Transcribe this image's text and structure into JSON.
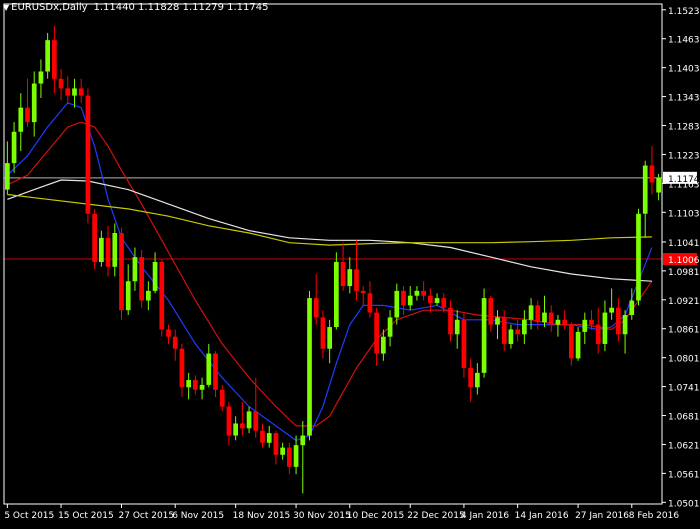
{
  "header": {
    "symbol": "EURUSDx,Daily",
    "ohlc": "1.11440 1.11828 1.11279 1.11745"
  },
  "price_tags": {
    "current": "1.11745",
    "line2": "1.10061"
  },
  "colors": {
    "background": "#000000",
    "axis": "#ffffff",
    "bull": "#7cff00",
    "bear": "#ff0000",
    "ma_fast": "#1e3cff",
    "ma_mid": "#d01010",
    "ma_long_white": "#e6e6e6",
    "ma_long_yellow": "#c8c800",
    "hline_current": "#b4b4b4",
    "hline_red": "#c80000",
    "tag_current_bg": "#ffffff",
    "tag_red_bg": "#ff0000"
  },
  "chart_data": {
    "type": "candlestick",
    "title": "EURUSDx,Daily",
    "y_ticks": [
      "1.15230",
      "1.14630",
      "1.14030",
      "1.13430",
      "1.12830",
      "1.12230",
      "1.11630",
      "1.11030",
      "1.10415",
      "1.09815",
      "1.09215",
      "1.08615",
      "1.08015",
      "1.07415",
      "1.06815",
      "1.06215",
      "1.05615",
      "1.05015"
    ],
    "y_tick_values": [
      1.1523,
      1.1463,
      1.1403,
      1.1343,
      1.1283,
      1.1223,
      1.1163,
      1.1103,
      1.10415,
      1.09815,
      1.09215,
      1.08615,
      1.08015,
      1.07415,
      1.06815,
      1.06215,
      1.05615,
      1.05015
    ],
    "ylim": [
      1.0498,
      1.1535
    ],
    "x_labels": [
      "5 Oct 2015",
      "15 Oct 2015",
      "27 Oct 2015",
      "6 Nov 2015",
      "18 Nov 2015",
      "30 Nov 2015",
      "10 Dec 2015",
      "22 Dec 2015",
      "4 Jan 2016",
      "14 Jan 2016",
      "27 Jan 2016",
      "8 Feb 2016"
    ],
    "x_label_bar_index": [
      0,
      8,
      17,
      25,
      34,
      43,
      51,
      60,
      68,
      76,
      85,
      93
    ],
    "candles": [
      {
        "o": 1.115,
        "h": 1.125,
        "l": 1.114,
        "c": 1.1205
      },
      {
        "o": 1.1205,
        "h": 1.129,
        "l": 1.1185,
        "c": 1.127
      },
      {
        "o": 1.127,
        "h": 1.135,
        "l": 1.123,
        "c": 1.132
      },
      {
        "o": 1.132,
        "h": 1.138,
        "l": 1.128,
        "c": 1.129
      },
      {
        "o": 1.129,
        "h": 1.1395,
        "l": 1.126,
        "c": 1.137
      },
      {
        "o": 1.137,
        "h": 1.142,
        "l": 1.134,
        "c": 1.1395
      },
      {
        "o": 1.1395,
        "h": 1.1475,
        "l": 1.138,
        "c": 1.146
      },
      {
        "o": 1.146,
        "h": 1.149,
        "l": 1.135,
        "c": 1.138
      },
      {
        "o": 1.138,
        "h": 1.14,
        "l": 1.1335,
        "c": 1.136
      },
      {
        "o": 1.136,
        "h": 1.1385,
        "l": 1.133,
        "c": 1.1345
      },
      {
        "o": 1.1345,
        "h": 1.138,
        "l": 1.132,
        "c": 1.136
      },
      {
        "o": 1.136,
        "h": 1.138,
        "l": 1.133,
        "c": 1.1345
      },
      {
        "o": 1.1345,
        "h": 1.136,
        "l": 1.108,
        "c": 1.11
      },
      {
        "o": 1.11,
        "h": 1.111,
        "l": 1.0985,
        "c": 1.1
      },
      {
        "o": 1.1,
        "h": 1.1065,
        "l": 1.099,
        "c": 1.105
      },
      {
        "o": 1.105,
        "h": 1.1075,
        "l": 1.097,
        "c": 1.099
      },
      {
        "o": 1.099,
        "h": 1.108,
        "l": 1.097,
        "c": 1.106
      },
      {
        "o": 1.106,
        "h": 1.107,
        "l": 1.088,
        "c": 1.09
      },
      {
        "o": 1.09,
        "h": 1.0995,
        "l": 1.089,
        "c": 1.096
      },
      {
        "o": 1.096,
        "h": 1.103,
        "l": 1.094,
        "c": 1.101
      },
      {
        "o": 1.101,
        "h": 1.1025,
        "l": 1.0905,
        "c": 1.092
      },
      {
        "o": 1.092,
        "h": 1.096,
        "l": 1.09,
        "c": 1.094
      },
      {
        "o": 1.094,
        "h": 1.102,
        "l": 1.0935,
        "c": 1.1
      },
      {
        "o": 1.1,
        "h": 1.1005,
        "l": 1.0845,
        "c": 1.086
      },
      {
        "o": 1.086,
        "h": 1.087,
        "l": 1.083,
        "c": 1.0845
      },
      {
        "o": 1.0845,
        "h": 1.086,
        "l": 1.0795,
        "c": 1.082
      },
      {
        "o": 1.082,
        "h": 1.083,
        "l": 1.072,
        "c": 1.074
      },
      {
        "o": 1.074,
        "h": 1.077,
        "l": 1.0715,
        "c": 1.0755
      },
      {
        "o": 1.0755,
        "h": 1.0765,
        "l": 1.0725,
        "c": 1.0735
      },
      {
        "o": 1.0735,
        "h": 1.076,
        "l": 1.0715,
        "c": 1.0745
      },
      {
        "o": 1.0745,
        "h": 1.083,
        "l": 1.074,
        "c": 1.081
      },
      {
        "o": 1.081,
        "h": 1.0815,
        "l": 1.072,
        "c": 1.0735
      },
      {
        "o": 1.0735,
        "h": 1.0745,
        "l": 1.069,
        "c": 1.07
      },
      {
        "o": 1.07,
        "h": 1.071,
        "l": 1.062,
        "c": 1.064
      },
      {
        "o": 1.064,
        "h": 1.068,
        "l": 1.063,
        "c": 1.0665
      },
      {
        "o": 1.0665,
        "h": 1.071,
        "l": 1.064,
        "c": 1.0655
      },
      {
        "o": 1.0655,
        "h": 1.07,
        "l": 1.0645,
        "c": 1.069
      },
      {
        "o": 1.069,
        "h": 1.076,
        "l": 1.0635,
        "c": 1.065
      },
      {
        "o": 1.065,
        "h": 1.0665,
        "l": 1.0615,
        "c": 1.0625
      },
      {
        "o": 1.0625,
        "h": 1.066,
        "l": 1.0615,
        "c": 1.0645
      },
      {
        "o": 1.0645,
        "h": 1.065,
        "l": 1.058,
        "c": 1.06
      },
      {
        "o": 1.06,
        "h": 1.0625,
        "l": 1.059,
        "c": 1.0615
      },
      {
        "o": 1.0615,
        "h": 1.0625,
        "l": 1.056,
        "c": 1.0575
      },
      {
        "o": 1.0575,
        "h": 1.064,
        "l": 1.056,
        "c": 1.062
      },
      {
        "o": 1.062,
        "h": 1.067,
        "l": 1.052,
        "c": 1.064
      },
      {
        "o": 1.064,
        "h": 1.094,
        "l": 1.063,
        "c": 1.0925
      },
      {
        "o": 1.0925,
        "h": 1.0975,
        "l": 1.087,
        "c": 1.0885
      },
      {
        "o": 1.0885,
        "h": 1.09,
        "l": 1.08,
        "c": 1.082
      },
      {
        "o": 1.082,
        "h": 1.088,
        "l": 1.079,
        "c": 1.0865
      },
      {
        "o": 1.0865,
        "h": 1.102,
        "l": 1.086,
        "c": 1.1
      },
      {
        "o": 1.1,
        "h": 1.104,
        "l": 1.094,
        "c": 1.095
      },
      {
        "o": 1.095,
        "h": 1.101,
        "l": 1.0935,
        "c": 1.0985
      },
      {
        "o": 1.0985,
        "h": 1.1045,
        "l": 1.092,
        "c": 1.094
      },
      {
        "o": 1.094,
        "h": 1.095,
        "l": 1.091,
        "c": 1.0935
      },
      {
        "o": 1.0935,
        "h": 1.096,
        "l": 1.0885,
        "c": 1.0895
      },
      {
        "o": 1.0895,
        "h": 1.0905,
        "l": 1.0785,
        "c": 1.081
      },
      {
        "o": 1.081,
        "h": 1.086,
        "l": 1.0795,
        "c": 1.0845
      },
      {
        "o": 1.0845,
        "h": 1.09,
        "l": 1.0825,
        "c": 1.0885
      },
      {
        "o": 1.0885,
        "h": 1.0955,
        "l": 1.087,
        "c": 1.094
      },
      {
        "o": 1.094,
        "h": 1.095,
        "l": 1.089,
        "c": 1.091
      },
      {
        "o": 1.091,
        "h": 1.095,
        "l": 1.09,
        "c": 1.093
      },
      {
        "o": 1.093,
        "h": 1.095,
        "l": 1.092,
        "c": 1.094
      },
      {
        "o": 1.094,
        "h": 1.096,
        "l": 1.092,
        "c": 1.093
      },
      {
        "o": 1.093,
        "h": 1.0945,
        "l": 1.0895,
        "c": 1.0915
      },
      {
        "o": 1.0915,
        "h": 1.0935,
        "l": 1.091,
        "c": 1.0925
      },
      {
        "o": 1.0925,
        "h": 1.0935,
        "l": 1.0895,
        "c": 1.0905
      },
      {
        "o": 1.0905,
        "h": 1.092,
        "l": 1.0835,
        "c": 1.085
      },
      {
        "o": 1.085,
        "h": 1.09,
        "l": 1.082,
        "c": 1.088
      },
      {
        "o": 1.088,
        "h": 1.0895,
        "l": 1.076,
        "c": 1.078
      },
      {
        "o": 1.078,
        "h": 1.08,
        "l": 1.071,
        "c": 1.074
      },
      {
        "o": 1.074,
        "h": 1.079,
        "l": 1.0725,
        "c": 1.077
      },
      {
        "o": 1.077,
        "h": 1.0945,
        "l": 1.076,
        "c": 1.0925
      },
      {
        "o": 1.0925,
        "h": 1.093,
        "l": 1.0855,
        "c": 1.087
      },
      {
        "o": 1.087,
        "h": 1.09,
        "l": 1.084,
        "c": 1.0885
      },
      {
        "o": 1.0885,
        "h": 1.09,
        "l": 1.0815,
        "c": 1.083
      },
      {
        "o": 1.083,
        "h": 1.087,
        "l": 1.082,
        "c": 1.086
      },
      {
        "o": 1.086,
        "h": 1.088,
        "l": 1.0835,
        "c": 1.085
      },
      {
        "o": 1.085,
        "h": 1.09,
        "l": 1.083,
        "c": 1.088
      },
      {
        "o": 1.088,
        "h": 1.0925,
        "l": 1.086,
        "c": 1.091
      },
      {
        "o": 1.091,
        "h": 1.092,
        "l": 1.086,
        "c": 1.0875
      },
      {
        "o": 1.0875,
        "h": 1.093,
        "l": 1.0865,
        "c": 1.0895
      },
      {
        "o": 1.0895,
        "h": 1.091,
        "l": 1.0855,
        "c": 1.087
      },
      {
        "o": 1.087,
        "h": 1.089,
        "l": 1.0845,
        "c": 1.088
      },
      {
        "o": 1.088,
        "h": 1.09,
        "l": 1.086,
        "c": 1.087
      },
      {
        "o": 1.087,
        "h": 1.0875,
        "l": 1.0785,
        "c": 1.08
      },
      {
        "o": 1.08,
        "h": 1.0865,
        "l": 1.0795,
        "c": 1.0855
      },
      {
        "o": 1.0855,
        "h": 1.0895,
        "l": 1.083,
        "c": 1.088
      },
      {
        "o": 1.088,
        "h": 1.09,
        "l": 1.086,
        "c": 1.087
      },
      {
        "o": 1.087,
        "h": 1.0905,
        "l": 1.081,
        "c": 1.083
      },
      {
        "o": 1.083,
        "h": 1.092,
        "l": 1.0815,
        "c": 1.0895
      },
      {
        "o": 1.0895,
        "h": 1.0945,
        "l": 1.088,
        "c": 1.0905
      },
      {
        "o": 1.0905,
        "h": 1.0925,
        "l": 1.0835,
        "c": 1.085
      },
      {
        "o": 1.085,
        "h": 1.09,
        "l": 1.081,
        "c": 1.089
      },
      {
        "o": 1.089,
        "h": 1.0945,
        "l": 1.088,
        "c": 1.092
      },
      {
        "o": 1.092,
        "h": 1.111,
        "l": 1.091,
        "c": 1.11
      },
      {
        "o": 1.11,
        "h": 1.121,
        "l": 1.105,
        "c": 1.12
      },
      {
        "o": 1.12,
        "h": 1.124,
        "l": 1.114,
        "c": 1.1165
      },
      {
        "o": 1.1144,
        "h": 1.11828,
        "l": 1.11279,
        "c": 1.11745
      }
    ],
    "moving_averages": [
      {
        "color_key": "ma_fast",
        "points": [
          [
            0,
            1.118
          ],
          [
            3,
            1.122
          ],
          [
            6,
            1.128
          ],
          [
            9,
            1.133
          ],
          [
            11,
            1.132
          ],
          [
            13,
            1.124
          ],
          [
            15,
            1.113
          ],
          [
            17,
            1.105
          ],
          [
            20,
            1.099
          ],
          [
            24,
            1.092
          ],
          [
            28,
            1.083
          ],
          [
            32,
            1.076
          ],
          [
            36,
            1.07
          ],
          [
            40,
            1.066
          ],
          [
            43,
            1.063
          ],
          [
            45,
            1.064
          ],
          [
            47,
            1.07
          ],
          [
            49,
            1.079
          ],
          [
            51,
            1.087
          ],
          [
            53,
            1.091
          ],
          [
            56,
            1.091
          ],
          [
            60,
            1.09
          ],
          [
            64,
            1.091
          ],
          [
            68,
            1.088
          ],
          [
            72,
            1.088
          ],
          [
            76,
            1.087
          ],
          [
            80,
            1.087
          ],
          [
            84,
            1.087
          ],
          [
            88,
            1.086
          ],
          [
            90,
            1.0865
          ],
          [
            92,
            1.089
          ],
          [
            94,
            1.096
          ],
          [
            96,
            1.103
          ]
        ]
      },
      {
        "color_key": "ma_mid",
        "points": [
          [
            0,
            1.116
          ],
          [
            3,
            1.118
          ],
          [
            6,
            1.123
          ],
          [
            9,
            1.128
          ],
          [
            11,
            1.129
          ],
          [
            13,
            1.128
          ],
          [
            15,
            1.124
          ],
          [
            17,
            1.119
          ],
          [
            20,
            1.112
          ],
          [
            24,
            1.102
          ],
          [
            28,
            1.092
          ],
          [
            32,
            1.083
          ],
          [
            36,
            1.076
          ],
          [
            40,
            1.07
          ],
          [
            43,
            1.066
          ],
          [
            46,
            1.066
          ],
          [
            48,
            1.068
          ],
          [
            50,
            1.073
          ],
          [
            52,
            1.078
          ],
          [
            55,
            1.084
          ],
          [
            58,
            1.088
          ],
          [
            62,
            1.09
          ],
          [
            66,
            1.09
          ],
          [
            70,
            1.089
          ],
          [
            74,
            1.0885
          ],
          [
            78,
            1.088
          ],
          [
            82,
            1.087
          ],
          [
            86,
            1.087
          ],
          [
            90,
            1.086
          ],
          [
            92,
            1.088
          ],
          [
            94,
            1.092
          ],
          [
            96,
            1.096
          ]
        ]
      },
      {
        "color_key": "ma_long_white",
        "points": [
          [
            0,
            1.113
          ],
          [
            4,
            1.115
          ],
          [
            8,
            1.117
          ],
          [
            12,
            1.1168
          ],
          [
            18,
            1.115
          ],
          [
            24,
            1.112
          ],
          [
            30,
            1.109
          ],
          [
            36,
            1.1065
          ],
          [
            42,
            1.105
          ],
          [
            48,
            1.1045
          ],
          [
            54,
            1.1045
          ],
          [
            60,
            1.104
          ],
          [
            66,
            1.103
          ],
          [
            72,
            1.101
          ],
          [
            78,
            1.099
          ],
          [
            84,
            1.0975
          ],
          [
            90,
            1.0965
          ],
          [
            96,
            1.096
          ]
        ]
      },
      {
        "color_key": "ma_long_yellow",
        "points": [
          [
            0,
            1.114
          ],
          [
            6,
            1.113
          ],
          [
            12,
            1.112
          ],
          [
            18,
            1.111
          ],
          [
            24,
            1.1095
          ],
          [
            30,
            1.1075
          ],
          [
            36,
            1.106
          ],
          [
            42,
            1.104
          ],
          [
            48,
            1.1035
          ],
          [
            54,
            1.1038
          ],
          [
            60,
            1.104
          ],
          [
            66,
            1.104
          ],
          [
            72,
            1.104
          ],
          [
            78,
            1.1042
          ],
          [
            84,
            1.1045
          ],
          [
            90,
            1.105
          ],
          [
            96,
            1.1052
          ]
        ]
      }
    ],
    "h_lines": [
      {
        "value": 1.11745,
        "color_key": "hline_current",
        "label_key": "current"
      },
      {
        "value": 1.10061,
        "color_key": "hline_red",
        "label_key": "line2"
      }
    ]
  }
}
